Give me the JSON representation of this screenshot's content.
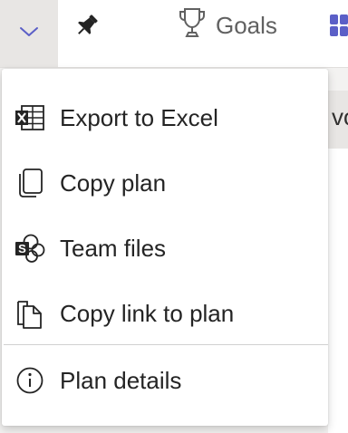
{
  "toolbar": {
    "dropdown_icon": "chevron-down-icon",
    "pin_icon": "pin-icon",
    "goals_label": "Goals",
    "goals_icon": "trophy-icon",
    "board_icon": "board-icon"
  },
  "background": {
    "partial_text": "vo"
  },
  "menu": {
    "items": [
      {
        "label": "Export to Excel",
        "icon": "excel-icon"
      },
      {
        "label": "Copy plan",
        "icon": "copy-icon"
      },
      {
        "label": "Team files",
        "icon": "sharepoint-icon"
      },
      {
        "label": "Copy link to plan",
        "icon": "copy-link-icon"
      },
      {
        "label": "Plan details",
        "icon": "info-icon"
      }
    ]
  },
  "colors": {
    "accent": "#5b5fc7",
    "text": "#242424",
    "muted": "#616161"
  }
}
